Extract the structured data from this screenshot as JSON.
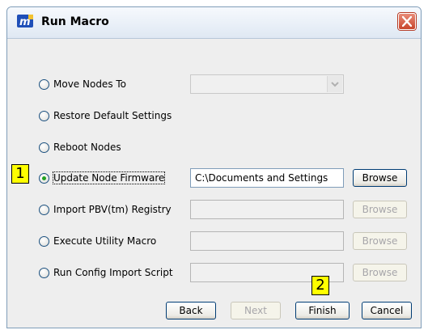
{
  "window": {
    "title": "Run Macro"
  },
  "options": [
    {
      "label": "Move Nodes To",
      "checked": false
    },
    {
      "label": "Restore Default Settings",
      "checked": false
    },
    {
      "label": "Reboot Nodes",
      "checked": false
    },
    {
      "label": "Update Node Firmware",
      "checked": true,
      "path_value": "C:\\Documents and Settings",
      "browse_label": "Browse"
    },
    {
      "label": "Import PBV(tm) Registry",
      "checked": false,
      "path_value": "",
      "browse_label": "Browse"
    },
    {
      "label": "Execute Utility Macro",
      "checked": false,
      "path_value": "",
      "browse_label": "Browse"
    },
    {
      "label": "Run Config Import Script",
      "checked": false,
      "path_value": "",
      "browse_label": "Browse"
    }
  ],
  "move_nodes_select": {
    "value": ""
  },
  "footer": {
    "back_label": "Back",
    "next_label": "Next",
    "finish_label": "Finish",
    "cancel_label": "Cancel"
  },
  "annotations": {
    "callout_1": "1",
    "callout_2": "2"
  },
  "colors": {
    "highlight": "#ffff00",
    "radio_selected": "#21a121",
    "close_button": "#c8452c"
  }
}
